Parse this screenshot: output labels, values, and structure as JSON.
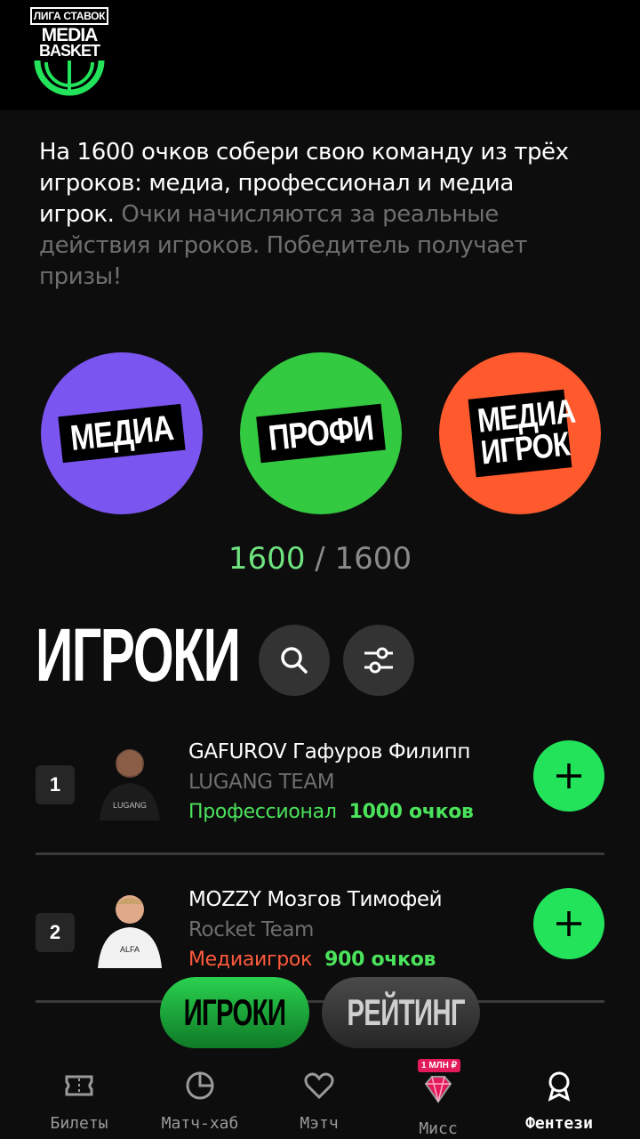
{
  "logo": {
    "line1": "ЛИГА СТАВОК",
    "line2": "MEDIA",
    "line3": "BASKET"
  },
  "intro": {
    "white_text": "На 1600 очков собери свою команду из трёх игроков: медиа, профессионал и медиа игрок.",
    "gray_text": "Очки начисляются за реальные действия игроков. Победитель получает призы!"
  },
  "categories": [
    {
      "label": "МЕДИА",
      "color": "#7b55f0"
    },
    {
      "label": "ПРОФИ",
      "color": "#33c940"
    },
    {
      "label": "МЕДИА ИГРОК",
      "color": "#ff5a2d"
    }
  ],
  "budget": {
    "current": "1600",
    "separator": "/",
    "max": "1600"
  },
  "players_section": {
    "title": "ИГРОКИ",
    "search_icon": "search-icon",
    "filter_icon": "sliders-icon"
  },
  "players": [
    {
      "rank": "1",
      "name": "GAFUROV Гафуров Филипп",
      "team": "LUGANG TEAM",
      "role": "Профессионал",
      "role_color": "#4be35c",
      "points": "1000 очков"
    },
    {
      "rank": "2",
      "name": "MOZZY Мозгов Тимофей",
      "team": "Rocket Team",
      "role": "Медиаигрок",
      "role_color": "#ff5a3c",
      "points": "900 очков"
    }
  ],
  "toggle": {
    "players_label": "ИГРОКИ",
    "rating_label": "РЕЙТИНГ"
  },
  "tabbar": {
    "tabs": [
      {
        "label": "Билеты",
        "icon": "ticket-icon"
      },
      {
        "label": "Матч-хаб",
        "icon": "pie-chart-icon"
      },
      {
        "label": "Мэтч",
        "icon": "heart-icon"
      },
      {
        "label": "Мисс",
        "icon": "diamond-icon",
        "badge": "1 МЛН ₽"
      },
      {
        "label": "Фентези",
        "icon": "award-icon"
      }
    ],
    "active": "Фентези"
  },
  "colors": {
    "accent_green": "#22e35a",
    "background": "#0d0d0d"
  }
}
